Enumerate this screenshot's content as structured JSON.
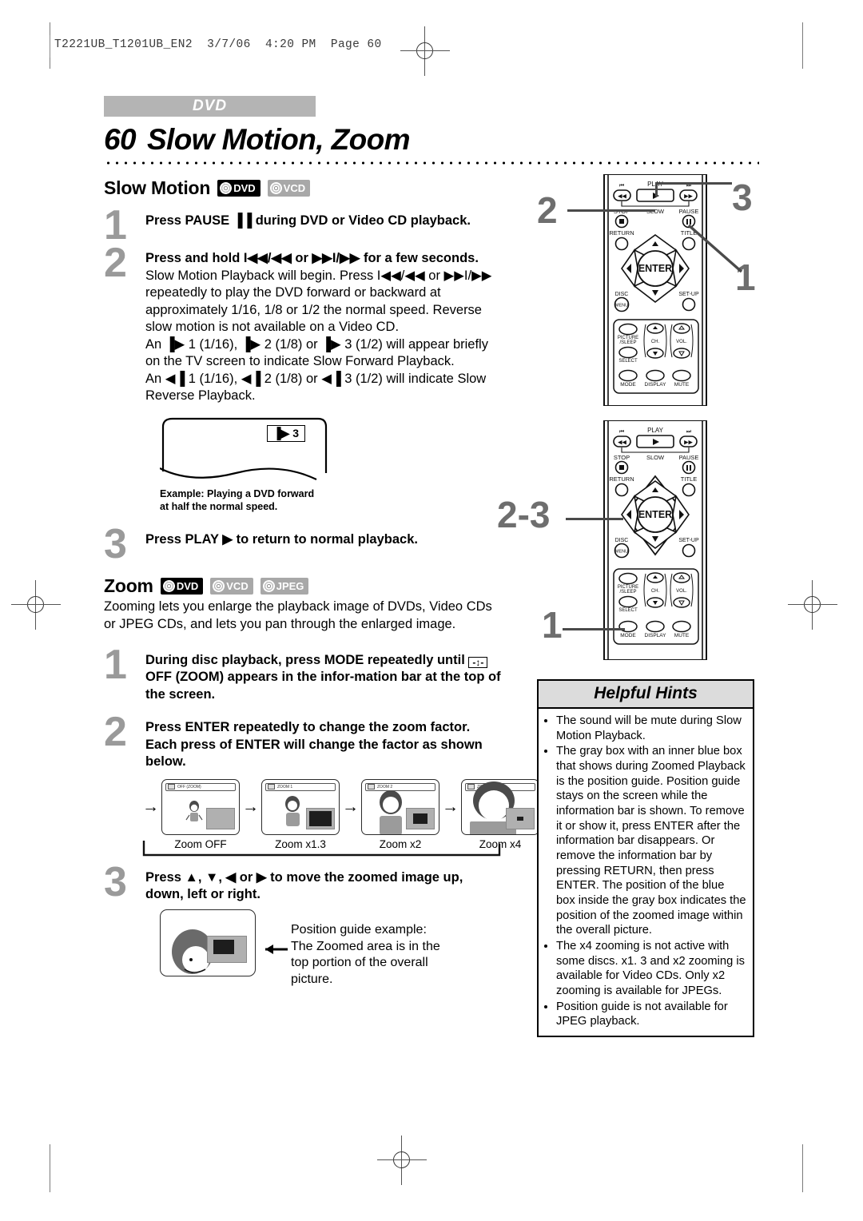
{
  "print_header": "T2221UB_T1201UB_EN2  3/7/06  4:20 PM  Page 60",
  "section_tag": "DVD",
  "page_number": "60",
  "page_title": "Slow Motion, Zoom",
  "slow_motion": {
    "heading": "Slow Motion",
    "badges": [
      "DVD",
      "VCD"
    ],
    "steps": [
      {
        "num": "1",
        "bold": "Press PAUSE ▐▐ during DVD or Video CD playback.",
        "rest": ""
      },
      {
        "num": "2",
        "bold": "Press and hold I◀◀/◀◀ or ▶▶I/▶▶ for a few seconds.",
        "rest": " Slow Motion Playback will begin. Press I◀◀/◀◀ or ▶▶I/▶▶ repeatedly to play the DVD forward or backward at approximately 1/16, 1/8 or 1/2 the normal speed. Reverse slow motion is not available on a Video CD.",
        "line2": "An ▐▶ 1 (1/16), ▐▶ 2 (1/8) or ▐▶ 3 (1/2) will appear briefly on the TV screen to indicate Slow Forward Playback.",
        "line3": "An ◀▐ 1 (1/16), ◀▐ 2 (1/8) or ◀▐ 3 (1/2) will indicate Slow Reverse Playback."
      },
      {
        "num": "3",
        "bold": "Press PLAY ▶ to return to normal playback.",
        "rest": ""
      }
    ],
    "tv_example_osd": "▐▶ 3",
    "tv_example_caption_l1": "Example: Playing a DVD forward",
    "tv_example_caption_l2": "at half the normal speed."
  },
  "zoom": {
    "heading": "Zoom",
    "badges": [
      "DVD",
      "VCD",
      "JPEG"
    ],
    "intro": "Zooming lets you enlarge the playback image of DVDs, Video CDs or JPEG CDs, and lets you pan through the enlarged image.",
    "steps": [
      {
        "num": "1",
        "text_a": "During disc playback, press MODE repeatedly until",
        "text_b": "OFF (ZOOM) appears in the infor-mation bar at the top of the screen."
      },
      {
        "num": "2",
        "text_a": "Press ENTER repeatedly to change the zoom factor. Each press of ENTER will change the factor as shown below."
      },
      {
        "num": "3",
        "text_a": "Press ▲, ▼, ◀ or ▶ to move the zoomed image up, down, left or right."
      }
    ],
    "chain": [
      {
        "osd": "OFF (ZOOM)",
        "label": "Zoom OFF",
        "inner": "none"
      },
      {
        "osd": "ZOOM 1",
        "label": "Zoom x1.3",
        "inner": "large"
      },
      {
        "osd": "ZOOM 2",
        "label": "Zoom x2",
        "inner": "medium"
      },
      {
        "osd": "ZOOM 3",
        "label": "Zoom x4",
        "inner": "small"
      }
    ],
    "posguide_caption": "Position guide example: The Zoomed area is in the top portion of the overall picture."
  },
  "helpful_hints": {
    "title": "Helpful Hints",
    "items": [
      "The sound will be mute during Slow Motion Playback.",
      "The gray box with an inner blue box that shows during Zoomed Playback is the position guide. Position guide stays on the screen while the information bar is shown. To remove it or show it, press ENTER after the information bar disappears. Or remove the information bar by pressing RETURN, then press ENTER. The position of the blue box inside the gray box indicates the position of the zoomed image within the overall picture.",
      "The x4 zooming is not active with some discs.  x1. 3 and x2 zooming is available for Video CDs. Only x2 zooming is available for JPEGs.",
      "Position guide is not available for JPEG playback."
    ]
  },
  "remote_top": {
    "callouts": [
      "2",
      "3",
      "1"
    ],
    "labels": {
      "skip_prev": "⏮",
      "play": "PLAY",
      "skip_next": "⏭",
      "rew": "◀◀",
      "play_btn": "▶",
      "ff": "▶▶",
      "stop": "STOP",
      "slow": "SLOW",
      "pause": "PAUSE",
      "return": "RETURN",
      "title": "TITLE",
      "enter": "ENTER",
      "disc": "DISC",
      "menu": "MENU",
      "setup": "SET-UP",
      "picture": "PICTURE",
      "sleep": "/SLEEP",
      "ch": "CH.",
      "vol": "VOL.",
      "select": "SELECT",
      "mode": "MODE",
      "display": "DISPLAY",
      "mute": "MUTE"
    }
  },
  "remote_bottom": {
    "callouts": [
      "2-3",
      "1"
    ]
  },
  "colors": {
    "tag_gray": "#b4b4b4",
    "step_number_gray": "#9a9a9a",
    "hint_header_gray": "#dcdcdc",
    "guide_gray": "#b0b0b0",
    "guide_inner": "#1d1d1d"
  }
}
